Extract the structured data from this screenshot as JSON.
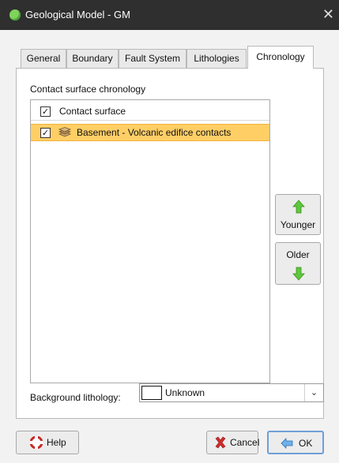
{
  "window": {
    "title": "Geological Model - GM",
    "close_glyph": "✕"
  },
  "tabs": [
    {
      "label": "General"
    },
    {
      "label": "Boundary"
    },
    {
      "label": "Fault System"
    },
    {
      "label": "Lithologies"
    },
    {
      "label": "Chronology",
      "active": true
    }
  ],
  "chronology": {
    "section_label": "Contact surface chronology",
    "list": {
      "header_label": "Contact surface",
      "items": [
        {
          "label": "Basement - Volcanic edifice contacts",
          "checked": true,
          "selected": true
        }
      ]
    },
    "younger_label": "Younger",
    "older_label": "Older"
  },
  "background": {
    "label": "Background lithology:",
    "value": "Unknown"
  },
  "footer": {
    "help_label": "Help",
    "cancel_label": "Cancel",
    "ok_label": "OK"
  },
  "icons": {
    "check": "✓",
    "dropdown": "⌄"
  },
  "colors": {
    "titlebar": "#2f2f2f",
    "selected_row": "#ffcf66",
    "arrow_green": "#5ec83a",
    "cancel_red": "#d12b2b"
  }
}
